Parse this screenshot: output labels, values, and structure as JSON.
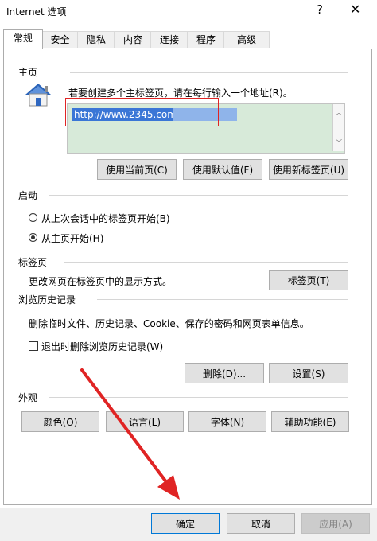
{
  "window": {
    "title": "Internet 选项",
    "help": "?",
    "close": "✕"
  },
  "tabs": [
    "常规",
    "安全",
    "隐私",
    "内容",
    "连接",
    "程序",
    "高级"
  ],
  "home": {
    "section": "主页",
    "instruction": "若要创建多个主标签页，请在每行输入一个地址(R)。",
    "url": "http://www.2345.com/",
    "buttons": {
      "current": "使用当前页(C)",
      "default": "使用默认值(F)",
      "newtab": "使用新标签页(U)"
    }
  },
  "startup": {
    "section": "启动",
    "option1": "从上次会话中的标签页开始(B)",
    "option2": "从主页开始(H)"
  },
  "tabsSection": {
    "section": "标签页",
    "desc": "更改网页在标签页中的显示方式。",
    "button": "标签页(T)"
  },
  "history": {
    "section": "浏览历史记录",
    "desc": "删除临时文件、历史记录、Cookie、保存的密码和网页表单信息。",
    "checkbox": "退出时删除浏览历史记录(W)",
    "delete": "删除(D)...",
    "settings": "设置(S)"
  },
  "appearance": {
    "section": "外观",
    "colors": "颜色(O)",
    "language": "语言(L)",
    "fonts": "字体(N)",
    "accessibility": "辅助功能(E)"
  },
  "footer": {
    "ok": "确定",
    "cancel": "取消",
    "apply": "应用(A)"
  },
  "colors": {
    "selection": "#3a76d6",
    "annotation": "#e02424",
    "homeboxBg": "#d7ead9"
  }
}
